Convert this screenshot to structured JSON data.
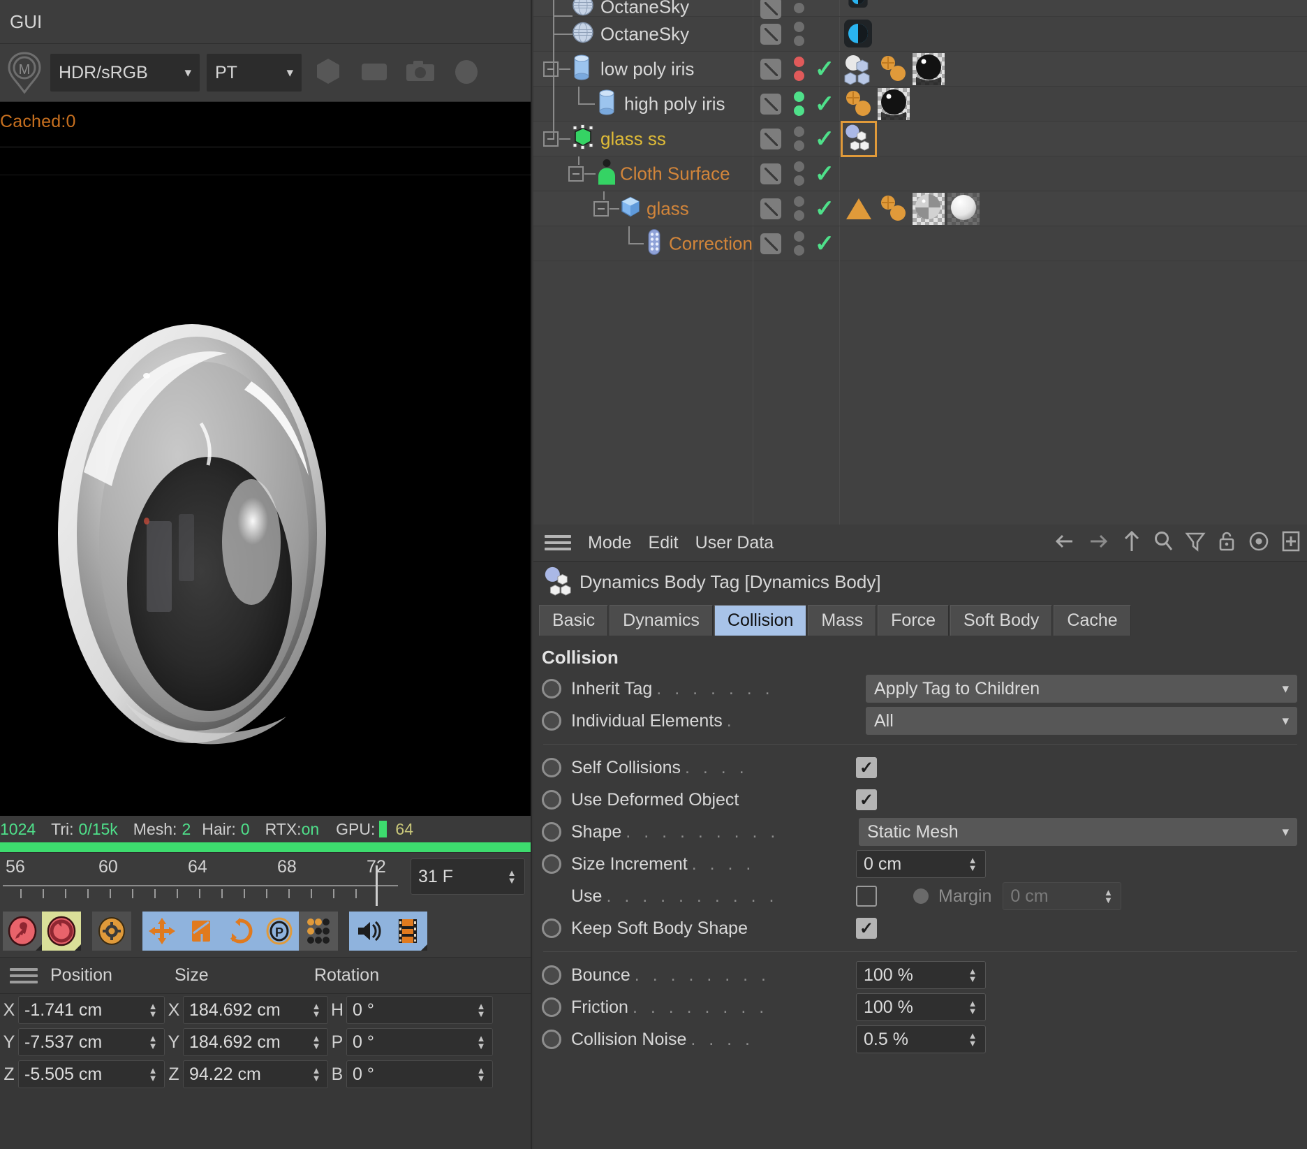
{
  "left_panel": {
    "title": "GUI",
    "render_toolbar": {
      "logo_icon": "octane-m-pin-icon",
      "colorspace_value": "HDR/sRGB",
      "kernel_value": "PT",
      "buttons": [
        {
          "icon": "hexagon-icon"
        },
        {
          "icon": "rounded-square-icon"
        },
        {
          "icon": "camera-icon"
        },
        {
          "icon": "sphere-icon"
        }
      ]
    },
    "viewport": {
      "cached_label": "Cached:0",
      "render_subject": "glass lens render"
    },
    "status_bar": {
      "samples": "1024",
      "tri_label": "Tri:",
      "tri_value": "0/15k",
      "mesh_label": "Mesh:",
      "mesh_value": "2",
      "hair_label": "Hair:",
      "hair_value": "0",
      "rtx_label": "RTX:",
      "rtx_value": "on",
      "gpu_label": "GPU:",
      "gpu_value": "64",
      "progress_color": "#3ddc6e"
    },
    "timeline": {
      "ticks": [
        "56",
        "60",
        "64",
        "68",
        "72"
      ],
      "current_frame": "31 F",
      "playhead_frame": 72
    },
    "icon_toolbar": [
      {
        "name": "record-key-button",
        "icon": "key-icon",
        "state": "grey"
      },
      {
        "name": "autokey-button",
        "icon": "cycle-icon",
        "state": "yellow"
      },
      {
        "name": "keyframe-settings-button",
        "icon": "gear-icon",
        "state": "dark"
      },
      {
        "name": "position-key-button",
        "icon": "move-arrows-icon",
        "state": "blue"
      },
      {
        "name": "scale-key-button",
        "icon": "scale-icon",
        "state": "blue"
      },
      {
        "name": "rotation-key-button",
        "icon": "rotate-icon",
        "state": "blue"
      },
      {
        "name": "parameter-key-button",
        "icon": "p-circle-icon",
        "state": "blue"
      },
      {
        "name": "point-level-animation-button",
        "icon": "dot-grid-icon",
        "state": "grey"
      },
      {
        "name": "sound-button",
        "icon": "speaker-icon",
        "state": "blue"
      },
      {
        "name": "filmstrip-button",
        "icon": "film-icon",
        "state": "blue"
      }
    ],
    "coordinates": {
      "columns": [
        "Position",
        "Size",
        "Rotation"
      ],
      "rows": [
        {
          "pos_axis": "X",
          "pos_value": "-1.741 cm",
          "size_axis": "X",
          "size_value": "184.692 cm",
          "rot_axis": "H",
          "rot_value": "0 °"
        },
        {
          "pos_axis": "Y",
          "pos_value": "-7.537 cm",
          "size_axis": "Y",
          "size_value": "184.692 cm",
          "rot_axis": "P",
          "rot_value": "0 °"
        },
        {
          "pos_axis": "Z",
          "pos_value": "-5.505 cm",
          "size_axis": "Z",
          "size_value": "94.22 cm",
          "rot_axis": "B",
          "rot_value": "0 °"
        }
      ]
    }
  },
  "object_manager": {
    "rows": [
      {
        "name": "OctaneSky",
        "name_color": "#d8d8d8",
        "indent": 1,
        "icon": "sky-globe-icon",
        "expander": false,
        "partial": true,
        "dots": [
          "grey",
          "grey"
        ],
        "check": false,
        "tags": [
          {
            "icon": "octane-environment-icon",
            "selected": false
          }
        ]
      },
      {
        "name": "OctaneSky",
        "name_color": "#d8d8d8",
        "indent": 1,
        "icon": "sky-globe-icon",
        "expander": false,
        "partial": false,
        "dots": [
          "grey",
          "grey"
        ],
        "check": false,
        "tags": [
          {
            "icon": "octane-environment-icon",
            "selected": false
          }
        ]
      },
      {
        "name": "low poly iris",
        "name_color": "#d8d8d8",
        "indent": 1,
        "icon": "cylinder-icon",
        "expander": true,
        "partial": false,
        "dots": [
          "red",
          "red"
        ],
        "check": true,
        "tags": [
          {
            "icon": "dynamics-body-tag-icon",
            "selected": false
          },
          {
            "icon": "octane-object-tag-icon",
            "selected": false
          },
          {
            "icon": "black-glossy-material-icon",
            "selected": false
          }
        ]
      },
      {
        "name": "high poly iris",
        "name_color": "#d8d8d8",
        "indent": 2,
        "icon": "cylinder-icon",
        "expander": false,
        "partial": false,
        "dots": [
          "green",
          "green"
        ],
        "check": true,
        "tags": [
          {
            "icon": "octane-object-tag-icon",
            "selected": false
          },
          {
            "icon": "black-glossy-material-icon",
            "selected": false
          }
        ]
      },
      {
        "name": "glass ss",
        "name_color": "#e0bc37",
        "indent": 1,
        "icon": "editable-mesh-green-icon",
        "expander": true,
        "partial": false,
        "dots": [
          "grey",
          "grey"
        ],
        "check": true,
        "tags": [
          {
            "icon": "dynamics-body-tag-icon",
            "selected": true
          }
        ]
      },
      {
        "name": "Cloth Surface",
        "name_color": "#d2853a",
        "indent": 2,
        "icon": "cloth-surface-icon",
        "expander": true,
        "partial": false,
        "dots": [
          "grey",
          "grey"
        ],
        "check": true,
        "tags": []
      },
      {
        "name": "glass",
        "name_color": "#d2853a",
        "indent": 3,
        "icon": "cube-blue-icon",
        "expander": true,
        "partial": false,
        "dots": [
          "grey",
          "grey"
        ],
        "check": true,
        "tags": [
          {
            "icon": "phong-tag-icon",
            "selected": false
          },
          {
            "icon": "octane-object-tag-icon",
            "selected": false
          },
          {
            "icon": "grey-checker-material-icon",
            "selected": false
          },
          {
            "icon": "white-glossy-material-icon",
            "selected": false
          }
        ]
      },
      {
        "name": "Correction",
        "name_color": "#d2853a",
        "indent": 4,
        "icon": "correction-deformer-icon",
        "expander": false,
        "partial": false,
        "dots": [
          "grey",
          "grey"
        ],
        "check": true,
        "tags": []
      }
    ]
  },
  "attribute_manager": {
    "menus": [
      "Mode",
      "Edit",
      "User Data"
    ],
    "header_icons": [
      "back-arrow-icon",
      "forward-arrow-icon",
      "up-arrow-icon",
      "search-icon",
      "filter-icon",
      "lock-icon",
      "target-icon",
      "add-panel-icon"
    ],
    "object_title": "Dynamics Body Tag [Dynamics Body]",
    "object_icon": "dynamics-body-tag-icon",
    "tabs": [
      {
        "label": "Basic",
        "active": false
      },
      {
        "label": "Dynamics",
        "active": false
      },
      {
        "label": "Collision",
        "active": true
      },
      {
        "label": "Mass",
        "active": false
      },
      {
        "label": "Force",
        "active": false
      },
      {
        "label": "Soft Body",
        "active": false
      },
      {
        "label": "Cache",
        "active": false
      }
    ],
    "active_tab_color": "#a8c3e8",
    "section_title": "Collision",
    "properties": [
      {
        "label": "Inherit Tag",
        "dots": ". . . . . . .",
        "type": "select",
        "value": "Apply Tag to Children",
        "ring": true
      },
      {
        "label": "Individual Elements",
        "dots": ".",
        "type": "select",
        "value": "All",
        "ring": true
      },
      {
        "label": "Self Collisions",
        "dots": ". . . .",
        "type": "checkbox",
        "value": true,
        "ring": true
      },
      {
        "label": "Use Deformed Object",
        "dots": "",
        "type": "checkbox",
        "value": true,
        "ring": true
      },
      {
        "label": "Shape",
        "dots": ". . . . . . . . .",
        "type": "select",
        "value": "Static Mesh",
        "ring": true
      },
      {
        "label": "Size Increment",
        "dots": ". . . .",
        "type": "number",
        "value": "0 cm",
        "ring": true
      },
      {
        "label": "Use",
        "dots": ". . . . . . . . . .",
        "type": "checkbox-margin",
        "value": false,
        "ring": false,
        "sub_label": "Margin",
        "sub_value": "0 cm"
      },
      {
        "label": "Keep Soft Body Shape",
        "dots": "",
        "type": "checkbox",
        "value": true,
        "ring": true
      },
      {
        "label": "Bounce",
        "dots": ". . . . . . . .",
        "type": "number",
        "value": "100 %",
        "ring": true
      },
      {
        "label": "Friction",
        "dots": ". . . . . . . .",
        "type": "number",
        "value": "100 %",
        "ring": true
      },
      {
        "label": "Collision Noise",
        "dots": ". . . .",
        "type": "number",
        "value": "0.5 %",
        "ring": true
      }
    ]
  }
}
